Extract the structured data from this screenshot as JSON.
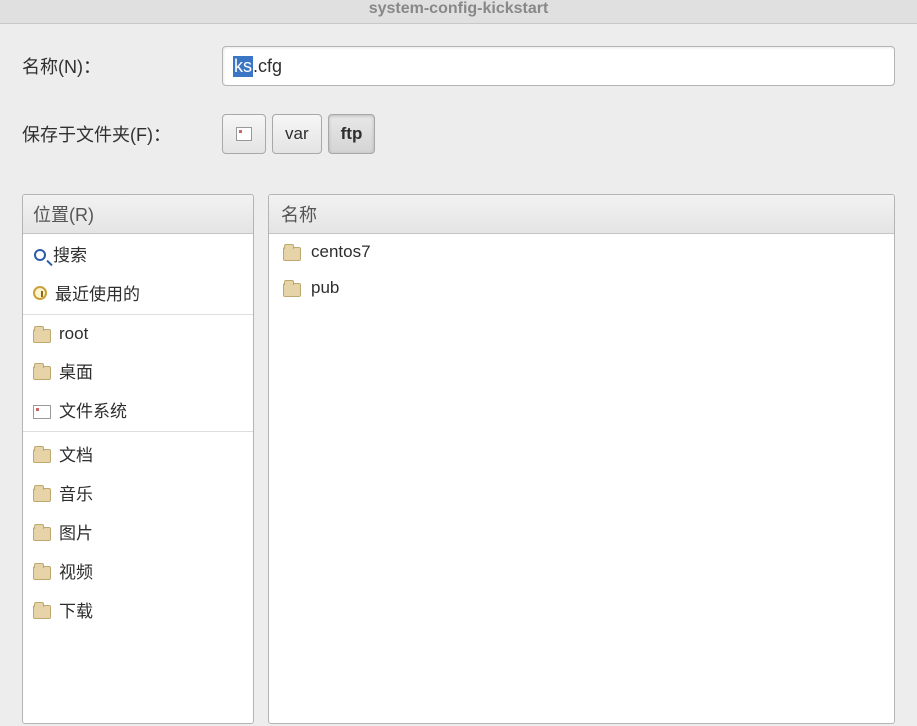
{
  "window": {
    "title": "system-config-kickstart"
  },
  "form": {
    "name_label": "名称(N)：",
    "filename_selected": "ks",
    "filename_rest": ".cfg",
    "folder_label": "保存于文件夹(F)："
  },
  "breadcrumb": [
    {
      "type": "icon"
    },
    {
      "label": "var",
      "active": false
    },
    {
      "label": "ftp",
      "active": true
    }
  ],
  "places": {
    "header": "位置(R)",
    "groups": [
      [
        {
          "icon": "search",
          "label": "搜索"
        },
        {
          "icon": "clock",
          "label": "最近使用的"
        }
      ],
      [
        {
          "icon": "folder",
          "label": "root"
        },
        {
          "icon": "folder",
          "label": "桌面"
        },
        {
          "icon": "drive",
          "label": "文件系统"
        }
      ],
      [
        {
          "icon": "folder",
          "label": "文档"
        },
        {
          "icon": "folder",
          "label": "音乐"
        },
        {
          "icon": "folder",
          "label": "图片"
        },
        {
          "icon": "folder",
          "label": "视频"
        },
        {
          "icon": "folder",
          "label": "下载"
        }
      ]
    ]
  },
  "filelist": {
    "header": "名称",
    "items": [
      {
        "icon": "folder",
        "name": "centos7"
      },
      {
        "icon": "folder",
        "name": "pub"
      }
    ]
  }
}
